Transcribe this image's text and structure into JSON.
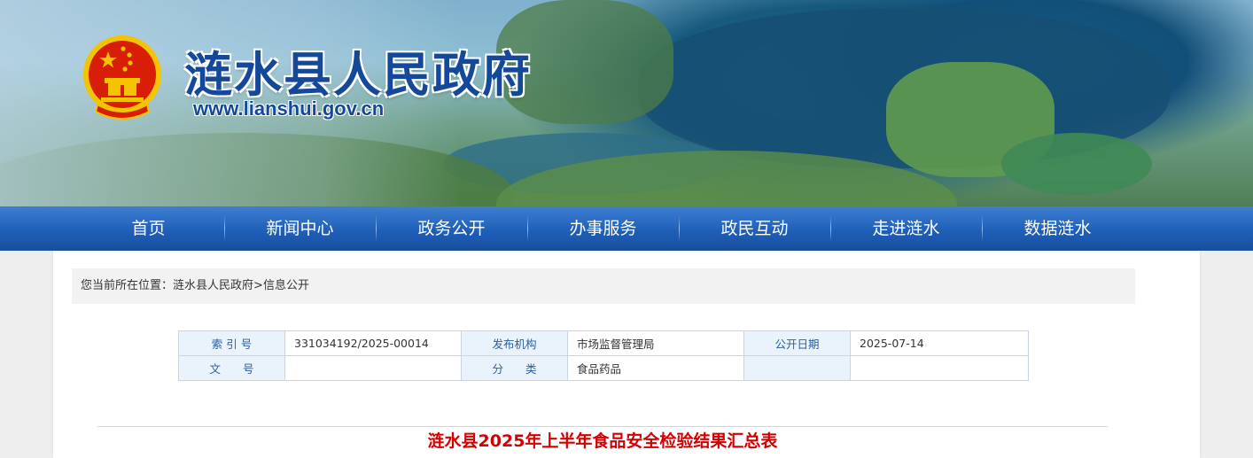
{
  "header": {
    "site_title": "涟水县人民政府",
    "site_url": "www.lianshui.gov.cn",
    "colors": {
      "title": "#14489a",
      "emblem_red": "#d81e06",
      "emblem_gold": "#f5c400"
    },
    "emblem_icon": "national-emblem-icon"
  },
  "nav": {
    "items": [
      "首页",
      "新闻中心",
      "政务公开",
      "办事服务",
      "政民互动",
      "走进涟水",
      "数据涟水"
    ]
  },
  "breadcrumb": {
    "prefix": "您当前所在位置：",
    "items": [
      "涟水县人民政府",
      "信息公开"
    ],
    "separator": ">"
  },
  "meta": {
    "index_label": "索 引 号",
    "index_value": "331034192/2025-00014",
    "publisher_label": "发布机构",
    "publisher_value": "市场监督管理局",
    "date_label": "公开日期",
    "date_value": "2025-07-14",
    "docno_label": "文　　号",
    "docno_value": "",
    "category_label": "分　　类",
    "category_value": "食品药品"
  },
  "article": {
    "title": "涟水县2025年上半年食品安全检验结果汇总表",
    "title_color": "#d40000"
  }
}
